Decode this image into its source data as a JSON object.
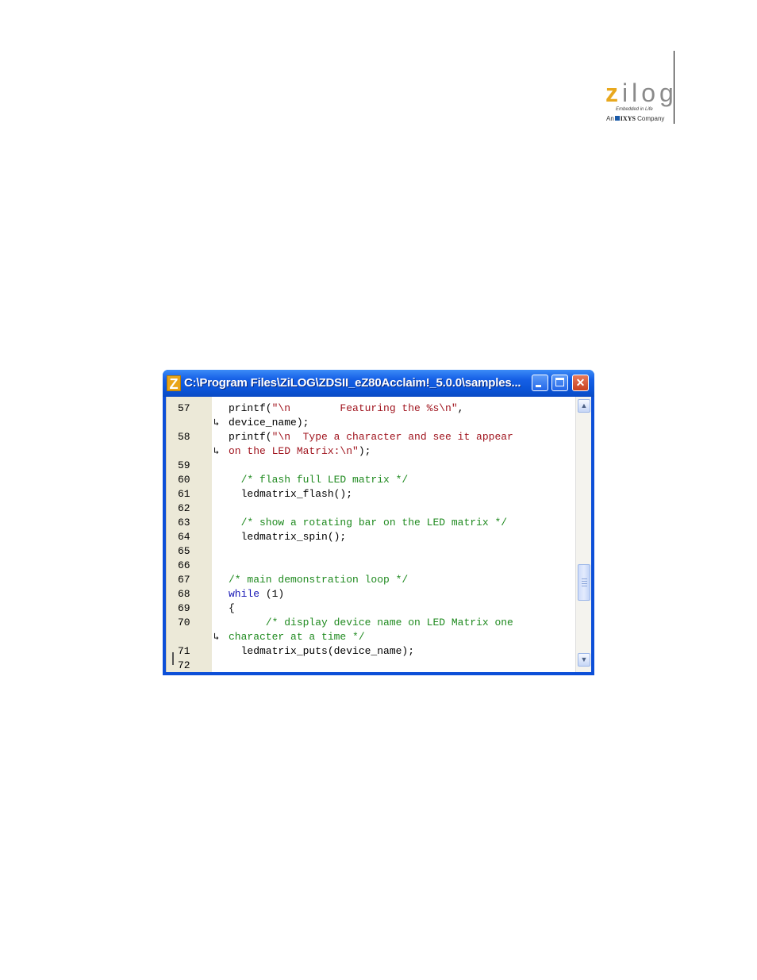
{
  "logo": {
    "word_initial": "z",
    "word_rest": "ilog",
    "tagline": "Embedded in Life",
    "company_prefix": "An",
    "company_name": "IXYS",
    "company_suffix": "Company",
    "accent_color": "#e8a81e"
  },
  "window": {
    "icon_letter": "Z",
    "title": "C:\\Program Files\\ZiLOG\\ZDSII_eZ80Acclaim!_5.0.0\\samples...",
    "buttons": {
      "minimize": "minimize-icon",
      "maximize": "maximize-icon",
      "close": "✕"
    }
  },
  "editor": {
    "lines": [
      {
        "num": "57",
        "wrap": "",
        "parts": [
          {
            "text": "printf(",
            "kind": "code"
          },
          {
            "text": "\"\\n        Featuring the %s\\n\"",
            "kind": "string"
          },
          {
            "text": ",",
            "kind": "code"
          }
        ]
      },
      {
        "num": "",
        "wrap": "↳",
        "parts": [
          {
            "text": "device_name);",
            "kind": "code"
          }
        ]
      },
      {
        "num": "58",
        "wrap": "",
        "parts": [
          {
            "text": "printf(",
            "kind": "code"
          },
          {
            "text": "\"\\n  Type a character and see it appear",
            "kind": "string"
          }
        ]
      },
      {
        "num": "",
        "wrap": "↳",
        "parts": [
          {
            "text": "on the LED Matrix:\\n\"",
            "kind": "string"
          },
          {
            "text": ");",
            "kind": "code"
          }
        ]
      },
      {
        "num": "59",
        "wrap": "",
        "parts": []
      },
      {
        "num": "60",
        "wrap": "",
        "parts": [
          {
            "text": "  /* flash full LED matrix */",
            "kind": "comment"
          }
        ]
      },
      {
        "num": "61",
        "wrap": "",
        "parts": [
          {
            "text": "  ledmatrix_flash();",
            "kind": "code"
          }
        ]
      },
      {
        "num": "62",
        "wrap": "",
        "parts": []
      },
      {
        "num": "63",
        "wrap": "",
        "parts": [
          {
            "text": "  /* show a rotating bar on the LED matrix */",
            "kind": "comment"
          }
        ]
      },
      {
        "num": "64",
        "wrap": "",
        "parts": [
          {
            "text": "  ledmatrix_spin();",
            "kind": "code"
          }
        ]
      },
      {
        "num": "65",
        "wrap": "",
        "parts": []
      },
      {
        "num": "66",
        "wrap": "",
        "parts": []
      },
      {
        "num": "67",
        "wrap": "",
        "parts": [
          {
            "text": "/* main demonstration loop */",
            "kind": "comment"
          }
        ]
      },
      {
        "num": "68",
        "wrap": "",
        "parts": [
          {
            "text": "while",
            "kind": "keyword"
          },
          {
            "text": " (1)",
            "kind": "code"
          }
        ]
      },
      {
        "num": "69",
        "wrap": "",
        "parts": [
          {
            "text": "{",
            "kind": "code"
          }
        ]
      },
      {
        "num": "70",
        "wrap": "",
        "parts": [
          {
            "text": "      /* display device name on LED Matrix one",
            "kind": "comment"
          }
        ]
      },
      {
        "num": "",
        "wrap": "↳",
        "parts": [
          {
            "text": "character at a time */",
            "kind": "comment"
          }
        ]
      },
      {
        "num": "71",
        "wrap": "",
        "parts": [
          {
            "text": "  ledmatrix_puts(device_name);",
            "kind": "code"
          }
        ]
      },
      {
        "num": "72",
        "wrap": "",
        "parts": []
      }
    ]
  },
  "scrollbar": {
    "up": "▲",
    "down": "▼"
  }
}
